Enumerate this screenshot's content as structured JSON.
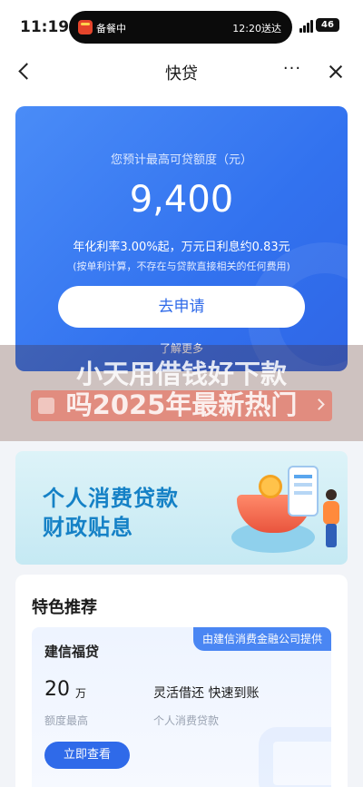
{
  "status_bar": {
    "time": "11:19",
    "activity": "备餐中",
    "eta": "12:20送达",
    "battery": "46"
  },
  "nav": {
    "title": "快贷",
    "more": "···"
  },
  "hero": {
    "label": "您预计最高可贷额度（元）",
    "amount": "9,400",
    "rate": "年化利率3.00%起，万元日利息约0.83元",
    "note": "(按单利计算，不存在与贷款直接相关的任何费用)",
    "apply_button": "去申请",
    "learn_more": "了解更多"
  },
  "overlay": {
    "title_line1": "小天用借钱好下款",
    "title_line2": "吗2025年最新热门"
  },
  "banner": {
    "line1": "个人消费贷款",
    "line2": "财政贴息"
  },
  "features": {
    "heading": "特色推荐",
    "product": {
      "provider": "由建信消费金融公司提供",
      "name": "建信福贷",
      "amount": "20",
      "unit": "万",
      "amount_label": "额度最高",
      "highlight": "灵活借还  快速到账",
      "type_label": "个人消费贷款",
      "button": "立即查看"
    }
  },
  "colors": {
    "primary": "#2f6ae9",
    "hero_gradient_start": "#4a8cf7",
    "banner_text": "#1581c6"
  }
}
